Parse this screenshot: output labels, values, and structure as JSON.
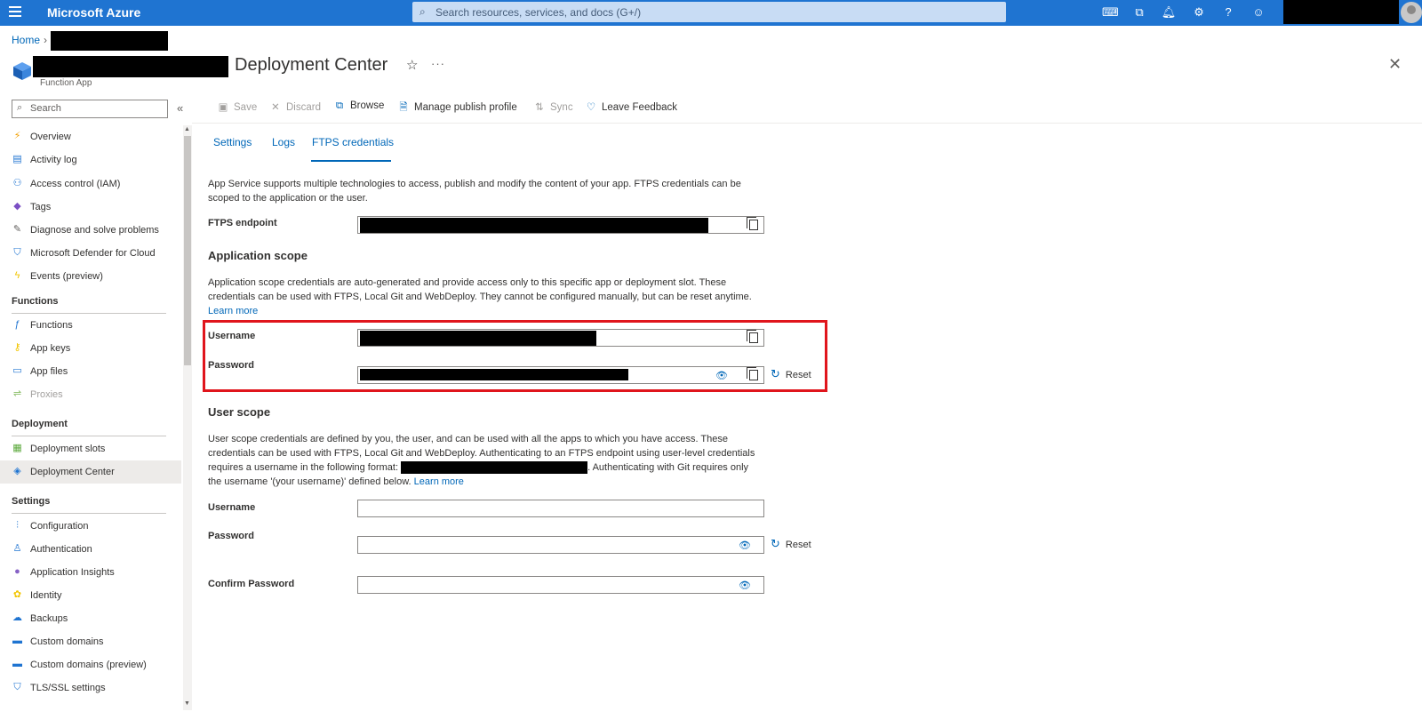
{
  "topbar": {
    "brand": "Microsoft Azure",
    "search_placeholder": "Search resources, services, and docs (G+/)"
  },
  "breadcrumb": {
    "home": "Home"
  },
  "resource": {
    "title": "Deployment Center",
    "subtitle": "Function App"
  },
  "sidebar": {
    "search_placeholder": "Search",
    "items_top": [
      {
        "label": "Overview",
        "icon": "lightning-icon"
      },
      {
        "label": "Activity log",
        "icon": "log-icon"
      },
      {
        "label": "Access control (IAM)",
        "icon": "people-icon"
      },
      {
        "label": "Tags",
        "icon": "tag-icon"
      },
      {
        "label": "Diagnose and solve problems",
        "icon": "wrench-icon"
      },
      {
        "label": "Microsoft Defender for Cloud",
        "icon": "shield-icon"
      },
      {
        "label": "Events (preview)",
        "icon": "bolt-icon"
      }
    ],
    "section_functions": "Functions",
    "items_functions": [
      {
        "label": "Functions",
        "icon": "function-icon"
      },
      {
        "label": "App keys",
        "icon": "key-icon"
      },
      {
        "label": "App files",
        "icon": "files-icon"
      },
      {
        "label": "Proxies",
        "icon": "proxy-icon"
      }
    ],
    "section_deployment": "Deployment",
    "items_deployment": [
      {
        "label": "Deployment slots",
        "icon": "slots-icon"
      },
      {
        "label": "Deployment Center",
        "icon": "cube-icon"
      }
    ],
    "section_settings": "Settings",
    "items_settings": [
      {
        "label": "Configuration",
        "icon": "sliders-icon"
      },
      {
        "label": "Authentication",
        "icon": "person-icon"
      },
      {
        "label": "Application Insights",
        "icon": "bulb-icon"
      },
      {
        "label": "Identity",
        "icon": "identity-icon"
      },
      {
        "label": "Backups",
        "icon": "cloud-icon"
      },
      {
        "label": "Custom domains",
        "icon": "www-icon"
      },
      {
        "label": "Custom domains (preview)",
        "icon": "www-icon"
      },
      {
        "label": "TLS/SSL settings",
        "icon": "shield-icon"
      }
    ]
  },
  "toolbar": {
    "save": "Save",
    "discard": "Discard",
    "browse": "Browse",
    "manage_publish_profile": "Manage publish profile",
    "sync": "Sync",
    "leave_feedback": "Leave Feedback"
  },
  "tabs": [
    "Settings",
    "Logs",
    "FTPS credentials"
  ],
  "ftps": {
    "intro": "App Service supports multiple technologies to access, publish and modify the content of your app. FTPS credentials can be scoped to the application or the user.",
    "endpoint_label": "FTPS endpoint",
    "app_scope_heading": "Application scope",
    "app_scope_desc": "Application scope credentials are auto-generated and provide access only to this specific app or deployment slot. These credentials can be used with FTPS, Local Git and WebDeploy. They cannot be configured manually, but can be reset anytime.",
    "learn_more": "Learn more",
    "username_label": "Username",
    "password_label": "Password",
    "reset": "Reset",
    "user_scope_heading": "User scope",
    "user_scope_desc_1": "User scope credentials are defined by you, the user, and can be used with all the apps to which you have access. These credentials can be used with FTPS, Local Git and WebDeploy. Authenticating to an FTPS endpoint using user-level credentials requires a username in the following format:",
    "user_scope_desc_2": ". Authenticating with Git requires only the username '(your username)' defined below.",
    "confirm_password_label": "Confirm Password"
  }
}
